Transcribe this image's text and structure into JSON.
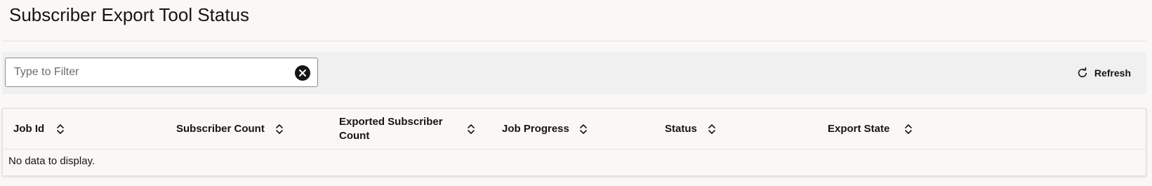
{
  "header": {
    "title": "Subscriber Export Tool Status"
  },
  "toolbar": {
    "filter": {
      "placeholder": "Type to Filter",
      "value": "",
      "clear_icon": "close-circle-icon"
    },
    "refresh": {
      "label": "Refresh",
      "icon": "refresh-icon"
    }
  },
  "table": {
    "columns": [
      {
        "label": "Job Id"
      },
      {
        "label": "Subscriber Count"
      },
      {
        "label": "Exported Subscriber Count"
      },
      {
        "label": "Job Progress"
      },
      {
        "label": "Status"
      },
      {
        "label": "Export State"
      }
    ],
    "rows": [],
    "empty_message": "No data to display."
  },
  "colors": {
    "background": "#f9f8f6",
    "toolbar_background": "#f1f0f0",
    "text": "#161513"
  }
}
